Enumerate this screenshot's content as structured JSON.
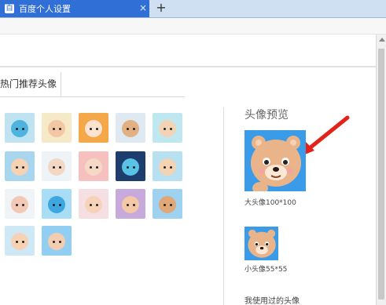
{
  "tab": {
    "title": "百度个人设置",
    "close": "×",
    "new_tab": "+",
    "favicon": "百"
  },
  "section_tab": "热门推荐头像",
  "preview": {
    "title": "头像预览",
    "large_label": "大头像100*100",
    "small_label": "小头像55*55",
    "used_label": "我使用过的头像"
  },
  "grid_avatars": [
    {
      "name": "blue-monster-avatar",
      "bg": "#bfe3f1",
      "face": "#4fb3e0"
    },
    {
      "name": "girl-brown-hair-avatar",
      "bg": "#f6e9c8",
      "face": "#f3c7a4"
    },
    {
      "name": "girl-orange-cat-avatar",
      "bg": "#f4a84a",
      "face": "#fbe3cf"
    },
    {
      "name": "bear-avatar",
      "bg": "#dfe9f2",
      "face": "#e2b083"
    },
    {
      "name": "boy-glasses-avatar",
      "bg": "#bfe7ef",
      "face": "#f2d3b6"
    },
    {
      "name": "boy-black-hair-avatar",
      "bg": "#a9d6ef",
      "face": "#f4d2b3"
    },
    {
      "name": "baby-bald-avatar",
      "bg": "#eef3f7",
      "face": "#f3d6c3"
    },
    {
      "name": "girl-glasses-red-avatar",
      "bg": "#f6c0bf",
      "face": "#f5d9c6"
    },
    {
      "name": "blue-rabbit-avatar",
      "bg": "#1d3d6e",
      "face": "#58c2e7"
    },
    {
      "name": "girl-flower-avatar",
      "bg": "#b7e0f1",
      "face": "#f3d3b4"
    },
    {
      "name": "boy-cap-avatar",
      "bg": "#f0f4f7",
      "face": "#f2c8b7"
    },
    {
      "name": "blue-monster-sky-avatar",
      "bg": "#a8ddf5",
      "face": "#3fa7df"
    },
    {
      "name": "girl-pink-avatar",
      "bg": "#f6dfe2",
      "face": "#f6d3b8"
    },
    {
      "name": "bald-man-purple-avatar",
      "bg": "#c8a9dc",
      "face": "#f3c8a4"
    },
    {
      "name": "bear-sky-avatar",
      "bg": "#9fd2f1",
      "face": "#e0a779"
    },
    {
      "name": "girl-bob-hair-avatar",
      "bg": "#cfe8f6",
      "face": "#f6d1b4"
    },
    {
      "name": "bald-man-sky-avatar",
      "bg": "#92cef2",
      "face": "#f4ccb0"
    }
  ],
  "colors": {
    "tab_active": "#2f6fd6",
    "arrow": "#e2231a",
    "avatar_bg": "#3a9be8"
  }
}
